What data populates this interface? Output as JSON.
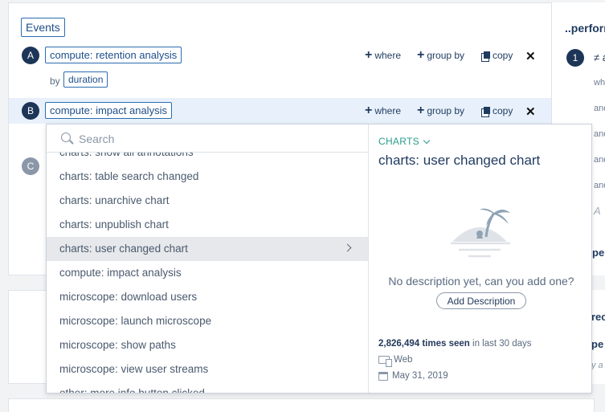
{
  "events_header": "Events",
  "rows": [
    {
      "badge": "A",
      "event": "compute: retention analysis",
      "by_label": "by",
      "group_tag": "duration"
    },
    {
      "badge": "B",
      "event": "compute: impact analysis"
    },
    {
      "badge": "C"
    }
  ],
  "actions": {
    "where": "where",
    "group_by": "group by",
    "copy": "copy",
    "close": "✕"
  },
  "right_panel": {
    "title": "..perforr",
    "badge": "1",
    "badge_text": "≠ a",
    "conditions": [
      "whe",
      "and",
      "and",
      "and",
      "and"
    ],
    "placeholder_a": "A",
    "perf": "pe",
    "second_a": "rec",
    "second_b": "pe",
    "second_c": "y a"
  },
  "dropdown": {
    "search_placeholder": "Search",
    "items": [
      "charts: show all annotations",
      "charts: table search changed",
      "charts: unarchive chart",
      "charts: unpublish chart",
      "charts: user changed chart",
      "compute: impact analysis",
      "microscope: download users",
      "microscope: launch microscope",
      "microscope: show paths",
      "microscope: view user streams",
      "other: more info button clicked"
    ],
    "active_index": 4
  },
  "detail": {
    "category": "CHARTS",
    "title": "charts: user changed chart",
    "description": "No description yet, can you add one?",
    "add_description": "Add Description",
    "seen_count": "2,826,494 times seen",
    "seen_period": " in last 30 days",
    "platform": "Web",
    "date": "May 31, 2019"
  },
  "colors": {
    "accent": "#2b6cb0",
    "teal": "#2a9d8f",
    "navy": "#1d3557",
    "highlight": "#e8f1fb"
  }
}
